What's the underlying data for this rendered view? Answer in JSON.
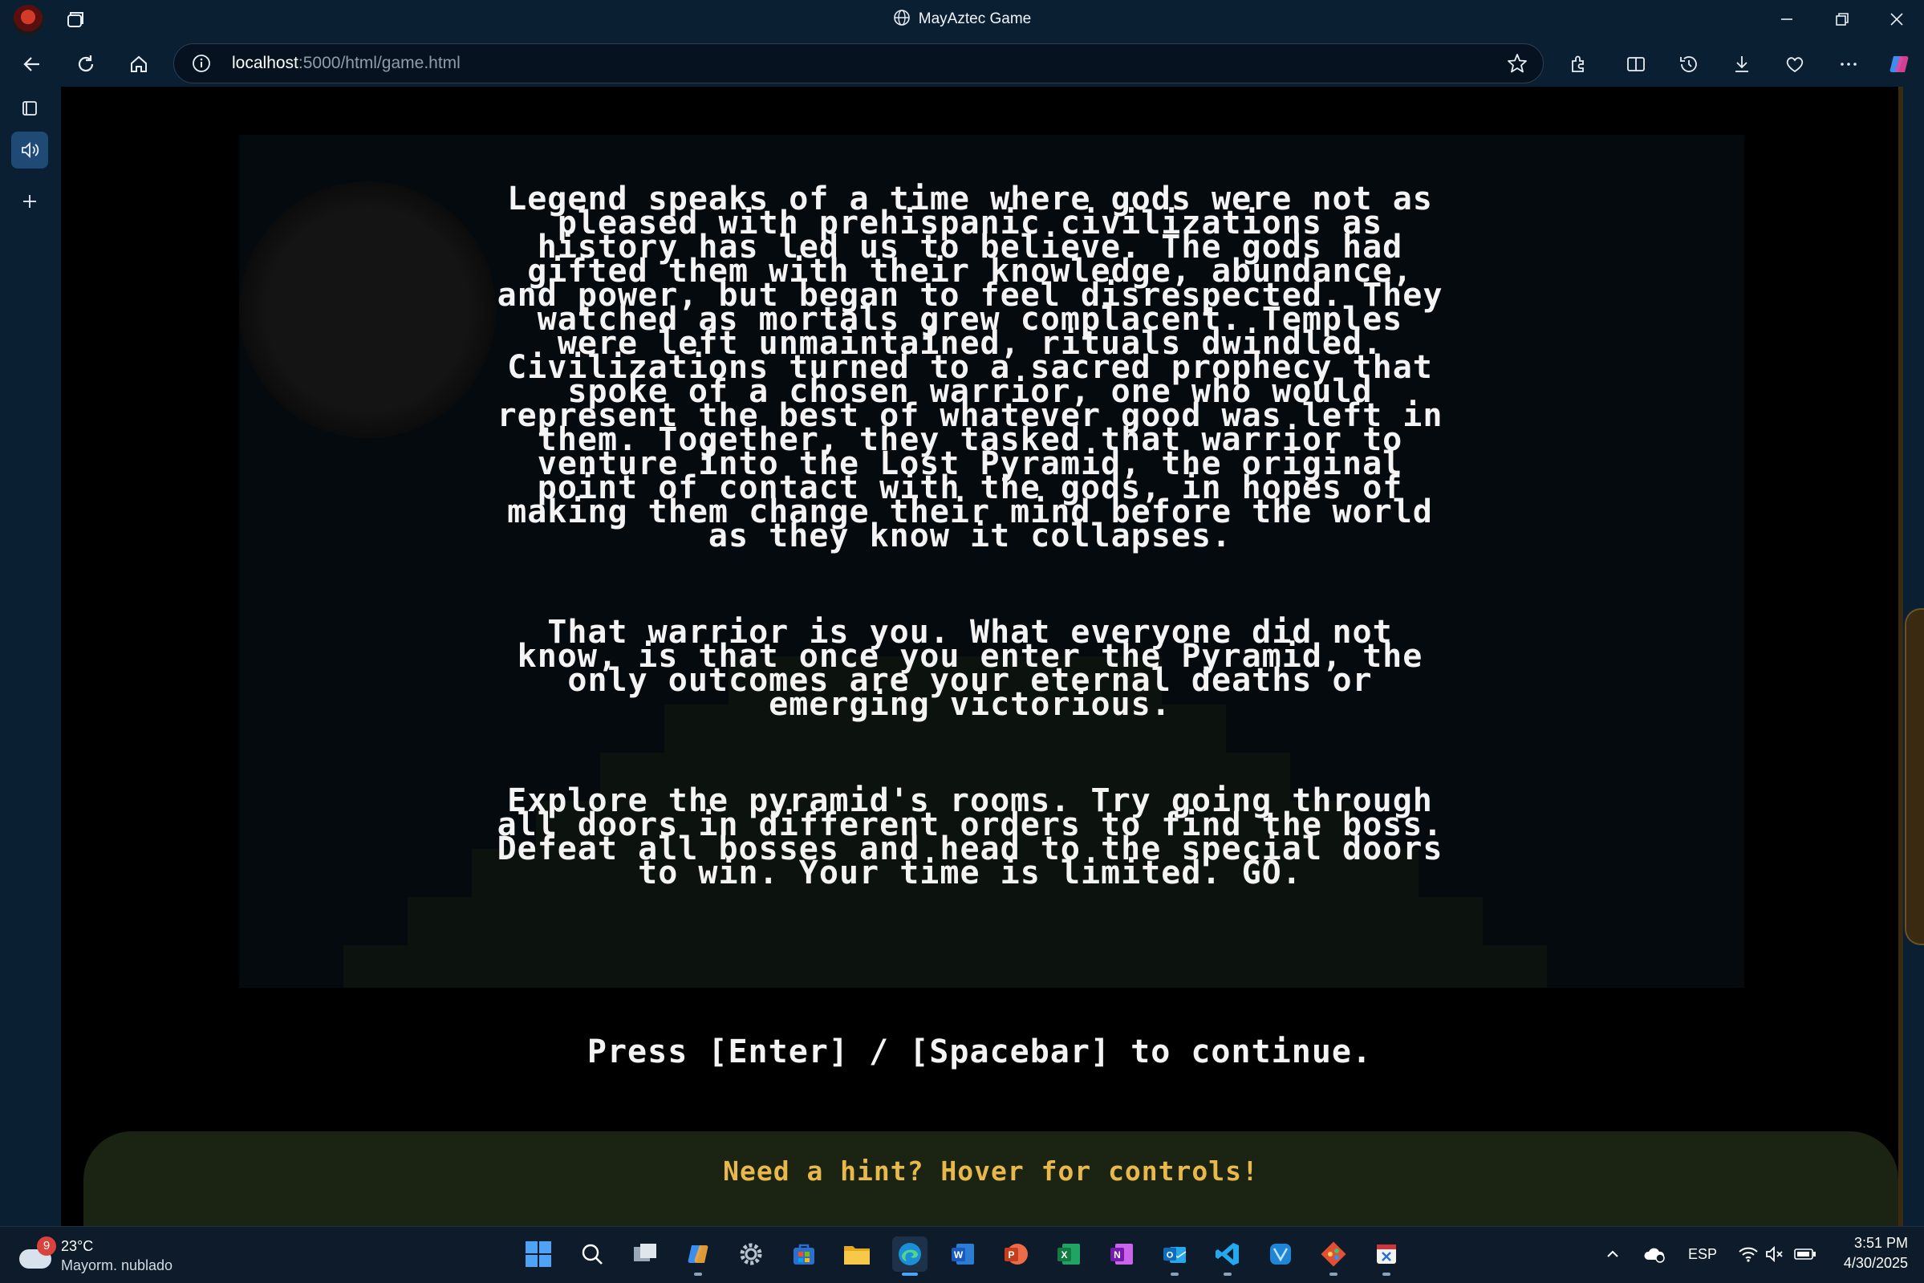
{
  "browser": {
    "window_title": "MayAztec Game",
    "url_host": "localhost",
    "url_path": ":5000/html/game.html"
  },
  "game": {
    "story_paragraphs": [
      "Legend speaks of a time where gods were not as pleased with prehispanic civilizations as history has led us to believe. The gods had gifted them with their knowledge, abundance, and power, but began to feel disrespected. They watched as mortals grew complacent. Temples were left unmaintained, rituals dwindled. Civilizations turned to a sacred prophecy that spoke of a chosen warrior, one who would represent the best of whatever good was left in them. Together, they tasked that warrior to venture into the Lost Pyramid, the original point of contact with the gods, in hopes of making them change their mind before the world as they know it collapses.",
      "That warrior is you. What everyone did not know, is that once you enter the Pyramid, the only outcomes are your eternal deaths or emerging victorious.",
      "Explore the pyramid's rooms. Try going through all doors in different orders to find the boss. Defeat all bosses and head to the special doors to win. Your time is limited. GO."
    ],
    "continue_prompt": "Press [Enter] / [Spacebar] to continue.",
    "hint_text": "Need a hint? Hover for controls!"
  },
  "taskbar": {
    "weather_badge": "9",
    "weather_temp": "23°C",
    "weather_condition": "Mayorm. nublado",
    "language": "ESP",
    "time": "3:51 PM",
    "date": "4/30/2025"
  },
  "colors": {
    "browser_chrome": "#0b1f33",
    "game_text": "#f4f4f4",
    "hint_text": "#e8b84a",
    "hint_bar": "#1b2313"
  }
}
